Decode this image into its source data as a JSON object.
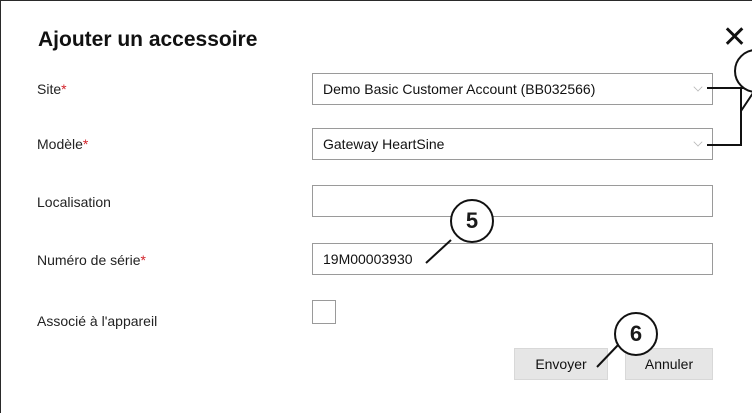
{
  "dialog": {
    "title": "Ajouter un accessoire",
    "close_glyph": "✕"
  },
  "form": {
    "site": {
      "label": "Site",
      "required_mark": "*",
      "value": "Demo Basic Customer Account (BB032566)"
    },
    "modele": {
      "label": "Modèle",
      "required_mark": "*",
      "value": "Gateway HeartSine"
    },
    "localisation": {
      "label": "Localisation",
      "value": ""
    },
    "numero_serie": {
      "label": "Numéro de série",
      "required_mark": "*",
      "value": "19M00003930"
    },
    "associe": {
      "label": "Associé à l'appareil",
      "checked": false
    }
  },
  "buttons": {
    "envoyer": "Envoyer",
    "annuler": "Annuler"
  },
  "callouts": {
    "five": "5",
    "six": "6"
  },
  "colors": {
    "required": "#d2232a",
    "button_bg": "#e6e6e6",
    "field_border": "#9a9a9a"
  }
}
